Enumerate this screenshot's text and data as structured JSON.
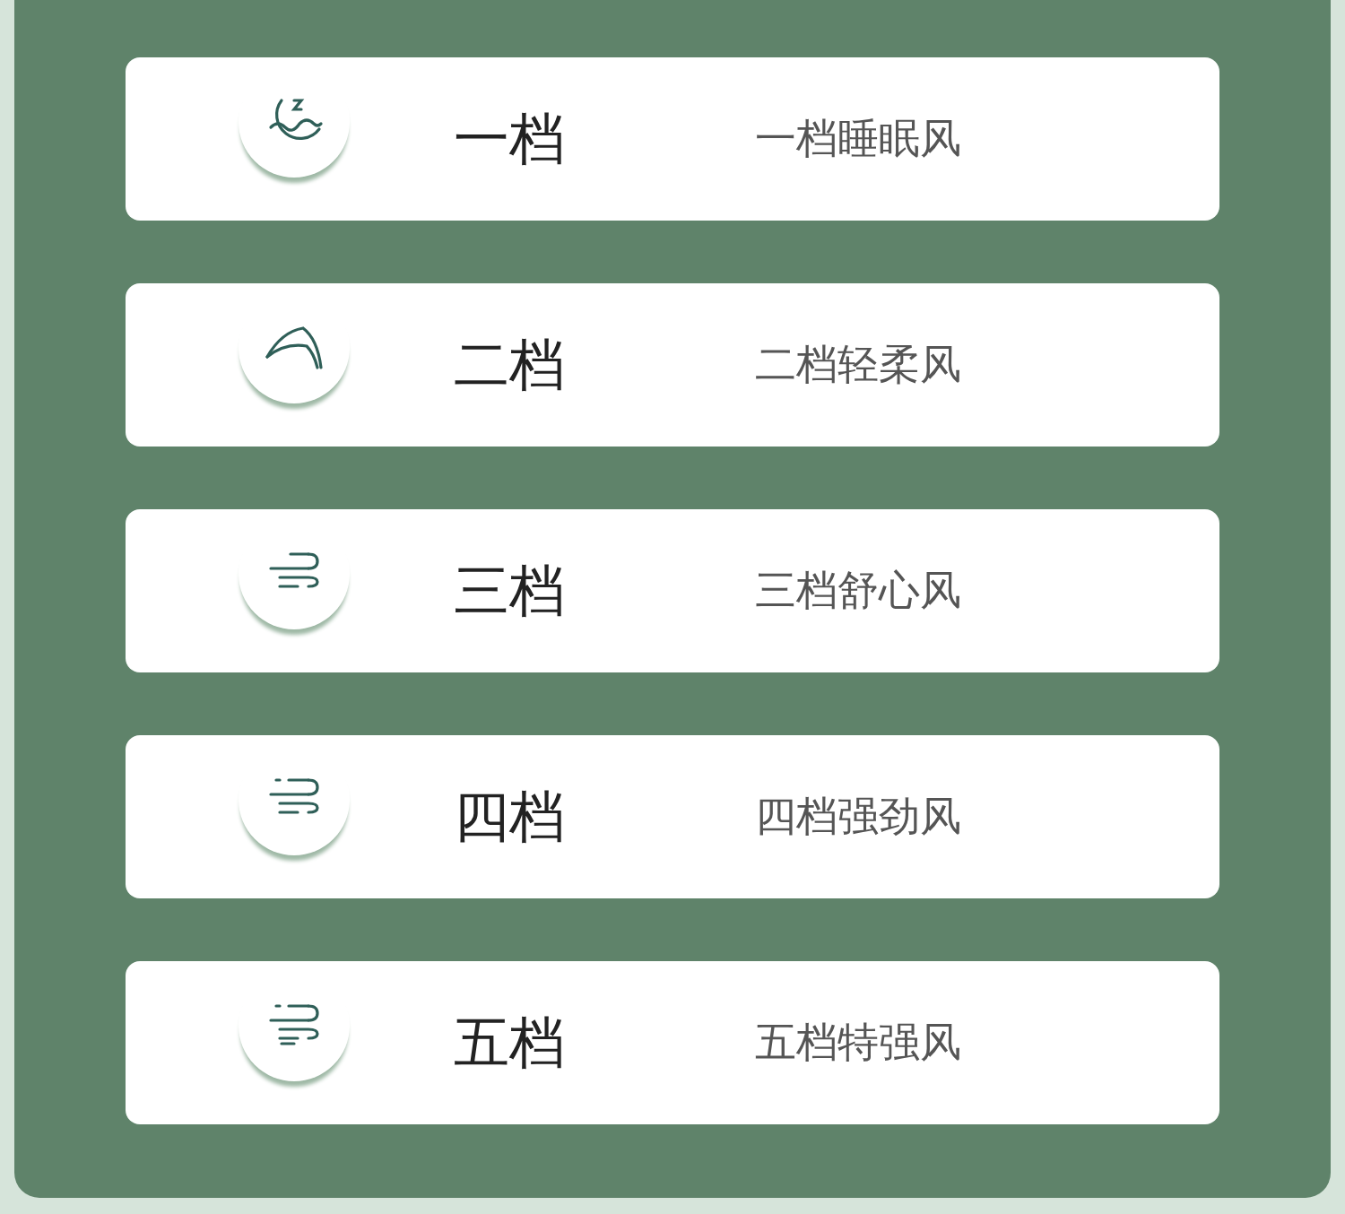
{
  "speeds": [
    {
      "kind": "moon",
      "name": "一档",
      "description": "一档睡眠风"
    },
    {
      "kind": "leaf",
      "name": "二档",
      "description": "二档轻柔风"
    },
    {
      "kind": "breeze",
      "name": "三档",
      "description": "三档舒心风"
    },
    {
      "kind": "wind",
      "name": "四档",
      "description": "四档强劲风"
    },
    {
      "kind": "gale",
      "name": "五档",
      "description": "五档特强风"
    }
  ]
}
